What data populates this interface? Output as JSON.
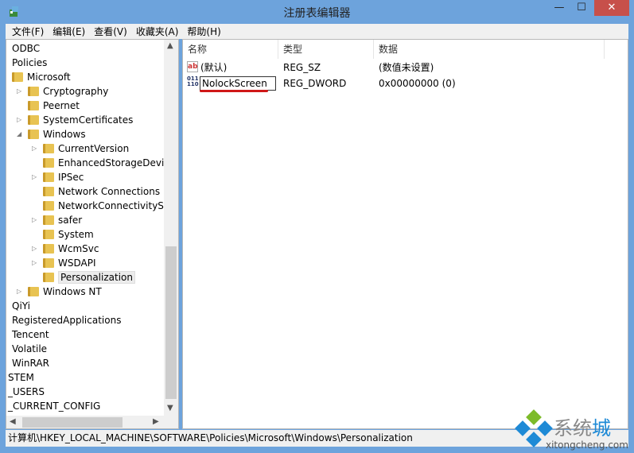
{
  "window": {
    "title": "注册表编辑器",
    "minimize": "—",
    "maximize": "☐",
    "close": "✕"
  },
  "menu": [
    "文件(F)",
    "编辑(E)",
    "查看(V)",
    "收藏夹(A)",
    "帮助(H)"
  ],
  "tree": [
    {
      "label": "ODBC",
      "level": 0,
      "folder": false
    },
    {
      "label": "Policies",
      "level": 0,
      "folder": false
    },
    {
      "label": "Microsoft",
      "level": 0,
      "folder": true,
      "expanded": true
    },
    {
      "label": "Cryptography",
      "level": 1,
      "folder": true,
      "expander": "collapsed"
    },
    {
      "label": "Peernet",
      "level": 1,
      "folder": true
    },
    {
      "label": "SystemCertificates",
      "level": 1,
      "folder": true,
      "expander": "collapsed"
    },
    {
      "label": "Windows",
      "level": 1,
      "folder": true,
      "expander": "expanded"
    },
    {
      "label": "CurrentVersion",
      "level": 2,
      "folder": true,
      "expander": "collapsed"
    },
    {
      "label": "EnhancedStorageDevic",
      "level": 2,
      "folder": true
    },
    {
      "label": "IPSec",
      "level": 2,
      "folder": true,
      "expander": "collapsed"
    },
    {
      "label": "Network Connections",
      "level": 2,
      "folder": true
    },
    {
      "label": "NetworkConnectivitySta",
      "level": 2,
      "folder": true
    },
    {
      "label": "safer",
      "level": 2,
      "folder": true,
      "expander": "collapsed"
    },
    {
      "label": "System",
      "level": 2,
      "folder": true
    },
    {
      "label": "WcmSvc",
      "level": 2,
      "folder": true,
      "expander": "collapsed"
    },
    {
      "label": "WSDAPI",
      "level": 2,
      "folder": true,
      "expander": "collapsed"
    },
    {
      "label": "Personalization",
      "level": 2,
      "folder": true,
      "selected": true
    },
    {
      "label": "Windows NT",
      "level": 1,
      "folder": true,
      "expander": "collapsed"
    },
    {
      "label": "QiYi",
      "level": 0,
      "folder": false
    },
    {
      "label": "RegisteredApplications",
      "level": 0,
      "folder": false
    },
    {
      "label": "Tencent",
      "level": 0,
      "folder": false
    },
    {
      "label": "Volatile",
      "level": 0,
      "folder": false
    },
    {
      "label": "WinRAR",
      "level": 0,
      "folder": false
    },
    {
      "label": "STEM",
      "level": -1,
      "folder": false
    },
    {
      "label": "_USERS",
      "level": -1,
      "folder": false
    },
    {
      "label": "_CURRENT_CONFIG",
      "level": -1,
      "folder": false
    }
  ],
  "columns": [
    "名称",
    "类型",
    "数据"
  ],
  "values": [
    {
      "icon": "string-value-icon",
      "name": "(默认)",
      "type": "REG_SZ",
      "data": "(数值未设置)"
    },
    {
      "icon": "binary-value-icon",
      "name": "NolockScreen",
      "type": "REG_DWORD",
      "data": "0x00000000 (0)",
      "editing": true
    }
  ],
  "status": "计算机\\HKEY_LOCAL_MACHINE\\SOFTWARE\\Policies\\Microsoft\\Windows\\Personalization",
  "watermark": {
    "text": "系统城",
    "url": "xitongcheng.com"
  }
}
